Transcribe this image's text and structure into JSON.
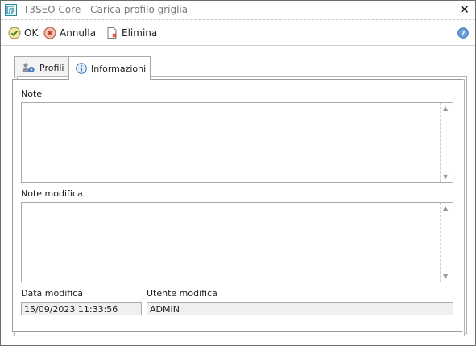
{
  "window": {
    "title": "T3SEO Core - Carica profilo griglia",
    "close_label": "✕"
  },
  "toolbar": {
    "ok_label": "OK",
    "cancel_label": "Annulla",
    "delete_label": "Elimina"
  },
  "tabs": [
    {
      "label": "Profili",
      "icon": "users-gear-icon",
      "active": false
    },
    {
      "label": "Informazioni",
      "icon": "info-icon",
      "active": true
    }
  ],
  "form": {
    "note_label": "Note",
    "note_value": "",
    "note_mod_label": "Note modifica",
    "note_mod_value": "",
    "date_label": "Data modifica",
    "date_value": "15/09/2023 11:33:56",
    "user_label": "Utente modifica",
    "user_value": "ADMIN"
  },
  "colors": {
    "window_border": "#6d6d6d",
    "field_bg": "#efefef",
    "accent_blue": "#2f6db3"
  }
}
